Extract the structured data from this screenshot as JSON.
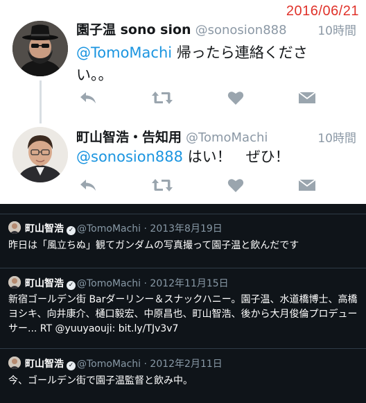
{
  "date_stamp": "2016/06/21",
  "thread": [
    {
      "name": "園子温 sono sion",
      "handle": "@sonosion888",
      "time": "10時間",
      "mention": "@TomoMachi",
      "text": " 帰ったら連絡ください。。",
      "avatar_icon": "person-with-hat-avatar"
    },
    {
      "name": "町山智浩・告知用",
      "handle": "@TomoMachi",
      "time": "10時間",
      "mention": "@sonosion888",
      "text": " はい！　ぜひ！",
      "avatar_icon": "person-glasses-avatar"
    }
  ],
  "action_icons": [
    "reply-icon",
    "retweet-icon",
    "like-icon",
    "message-icon"
  ],
  "old_tweets": [
    {
      "name": "町山智浩",
      "handle": "@TomoMachi",
      "date": "· 2013年8月19日",
      "text": "昨日は「風立ちぬ」観てガンダムの写真撮って園子温と飲んだです"
    },
    {
      "name": "町山智浩",
      "handle": "@TomoMachi",
      "date": "· 2012年11月15日",
      "text": "新宿ゴールデン街 Barダーリンー＆スナックハニー。園子温、水道橋博士、高橋ヨシキ、向井康介、樋口毅宏、中原昌也、町山智浩、後から大月俊倫プロデューサー... RT @yuuyaouji:  bit.ly/TJv3v7"
    },
    {
      "name": "町山智浩",
      "handle": "@TomoMachi",
      "date": "· 2012年2月11日",
      "text": "今、ゴールデン街で園子温監督と飲み中。"
    }
  ],
  "colors": {
    "mention": "#1b95e0",
    "date_stamp": "#e0322a",
    "dark_bg": "#0f1419",
    "icon_gray": "#8b98a5"
  }
}
